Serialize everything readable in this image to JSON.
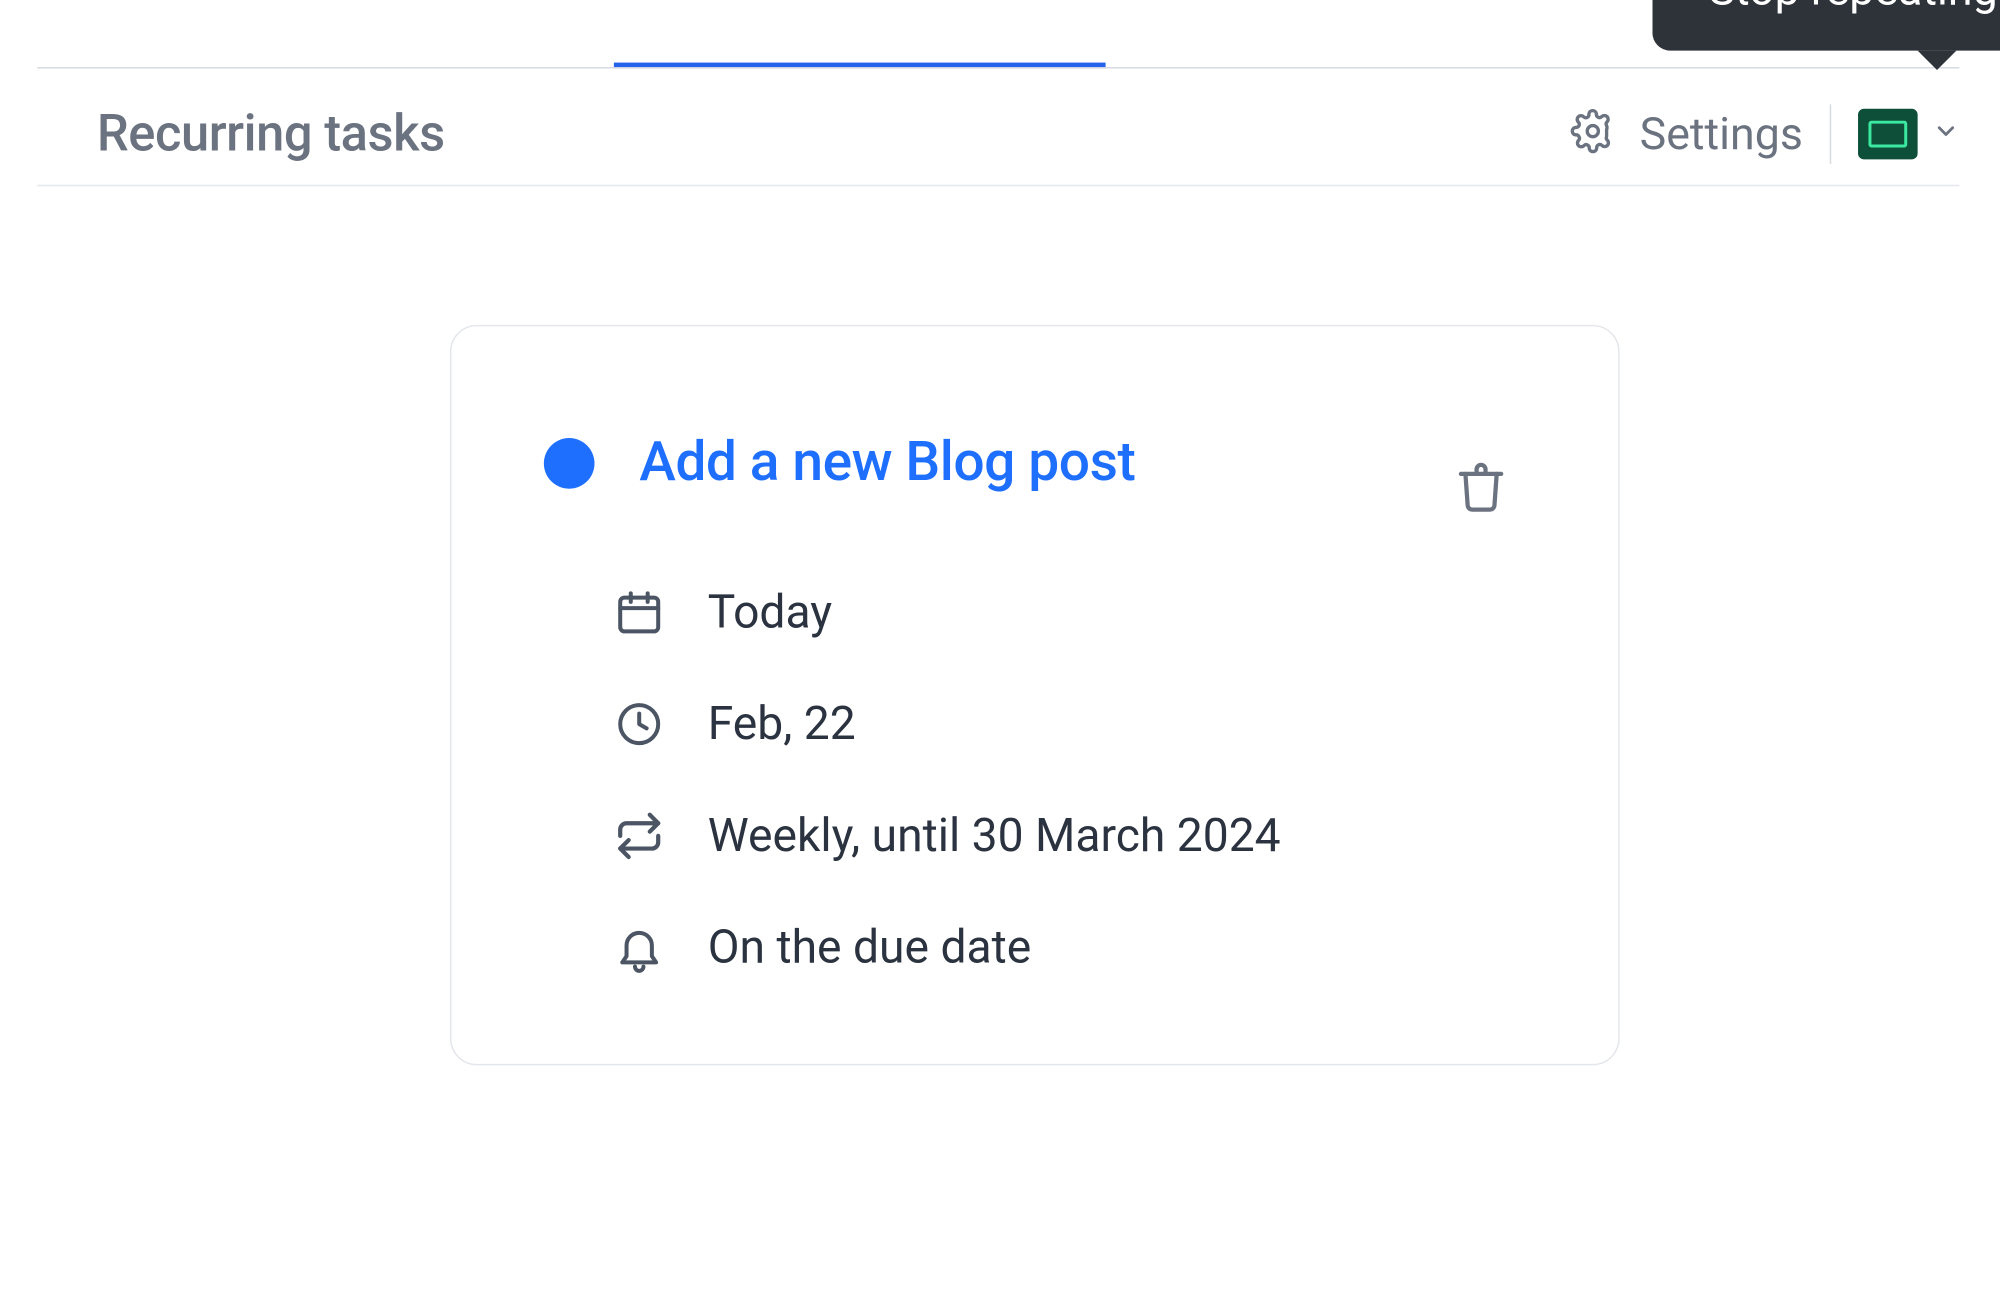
{
  "header": {
    "title": "Recurring tasks",
    "settings_label": "Settings"
  },
  "tooltip": {
    "delete": "Stop repeating task"
  },
  "task": {
    "title": "Add a new Blog post",
    "due": "Today",
    "time": "Feb, 22",
    "recurrence": "Weekly, until  30 March 2024",
    "reminder": "On the due date"
  }
}
